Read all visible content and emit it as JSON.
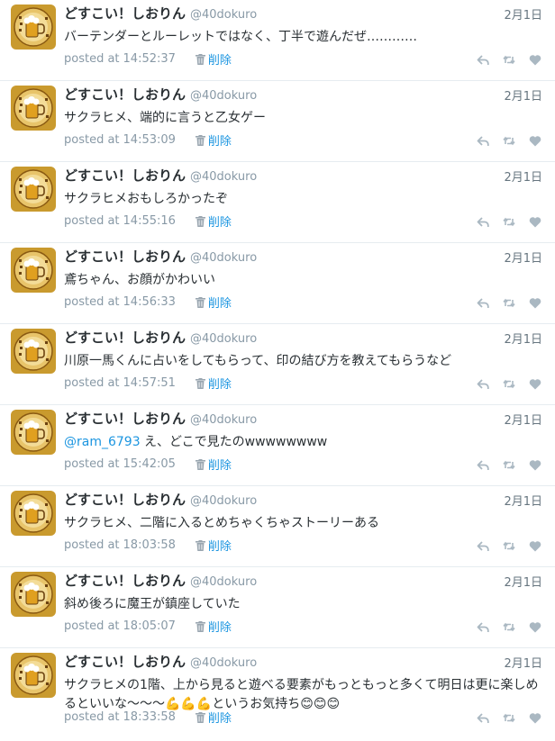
{
  "user": {
    "display_name": "どすこい！しおりん",
    "handle": "@40dokuro"
  },
  "labels": {
    "posted_at": "posted at",
    "delete": "削除"
  },
  "colors": {
    "link": "#1b95e0",
    "meta_text": "#8899a6",
    "divider": "#e6ecf0",
    "avatar_bg": "#c99a2e"
  },
  "icons": [
    "trash-icon",
    "reply-icon",
    "retweet-icon",
    "like-icon"
  ],
  "tweets": [
    {
      "date": "2月1日",
      "mention": "",
      "text": "バーテンダーとルーレットではなく、丁半で遊んだぜ…………",
      "time": "14:52:37"
    },
    {
      "date": "2月1日",
      "mention": "",
      "text": "サクラヒメ、端的に言うと乙女ゲー",
      "time": "14:53:09"
    },
    {
      "date": "2月1日",
      "mention": "",
      "text": "サクラヒメおもしろかったぞ",
      "time": "14:55:16"
    },
    {
      "date": "2月1日",
      "mention": "",
      "text": "鳶ちゃん、お顔がかわいい",
      "time": "14:56:33"
    },
    {
      "date": "2月1日",
      "mention": "",
      "text": "川原一馬くんに占いをしてもらって、印の結び方を教えてもらうなど",
      "time": "14:57:51"
    },
    {
      "date": "2月1日",
      "mention": "@ram_6793",
      "text": " え、どこで見たのwwwwwwww",
      "time": "15:42:05"
    },
    {
      "date": "2月1日",
      "mention": "",
      "text": "サクラヒメ、二階に入るとめちゃくちゃストーリーある",
      "time": "18:03:58"
    },
    {
      "date": "2月1日",
      "mention": "",
      "text": "斜め後ろに魔王が鎮座していた",
      "time": "18:05:07"
    },
    {
      "date": "2月1日",
      "mention": "",
      "text": "サクラヒメの1階、上から見ると遊べる要素がもっともっと多くて明日は更に楽しめるといいな〜〜〜💪💪💪というお気持ち😊😊😊",
      "time": "18:33:58"
    }
  ]
}
